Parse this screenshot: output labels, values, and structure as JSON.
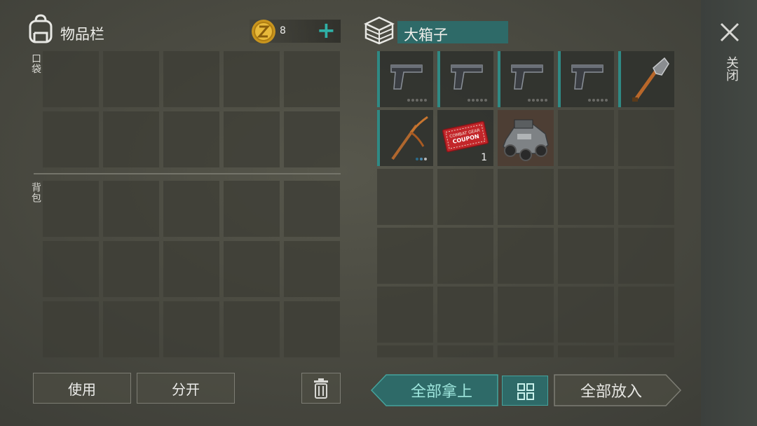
{
  "inventory": {
    "title": "物品栏",
    "coins": "8",
    "add_symbol": "+",
    "pocket_label": "口袋",
    "backpack_label": "背包",
    "use_label": "使用",
    "split_label": "分开"
  },
  "container": {
    "title": "大箱子",
    "close_label": "关闭",
    "take_all_label": "全部拿上",
    "put_all_label": "全部放入",
    "items": [
      {
        "name": "pistol",
        "icon": "pistol-icon",
        "durability_dots": 5
      },
      {
        "name": "pistol",
        "icon": "pistol-icon",
        "durability_dots": 5
      },
      {
        "name": "pistol",
        "icon": "pistol-icon",
        "durability_dots": 5
      },
      {
        "name": "pistol",
        "icon": "pistol-icon",
        "durability_dots": 5
      },
      {
        "name": "shovel",
        "icon": "shovel-icon"
      },
      {
        "name": "pickaxe",
        "icon": "pickaxe-icon",
        "durability_dots": 3
      },
      {
        "name": "combat gear coupon",
        "icon": "coupon-icon",
        "label_top": "COMBAT GEAR",
        "label_bottom": "COUPON",
        "quantity": "1"
      },
      {
        "name": "armored vehicle",
        "icon": "vehicle-icon"
      }
    ]
  },
  "colors": {
    "accent_teal": "#2f8a85",
    "teal_button": "#2e6a68",
    "coin_gold": "#e0b12d"
  }
}
